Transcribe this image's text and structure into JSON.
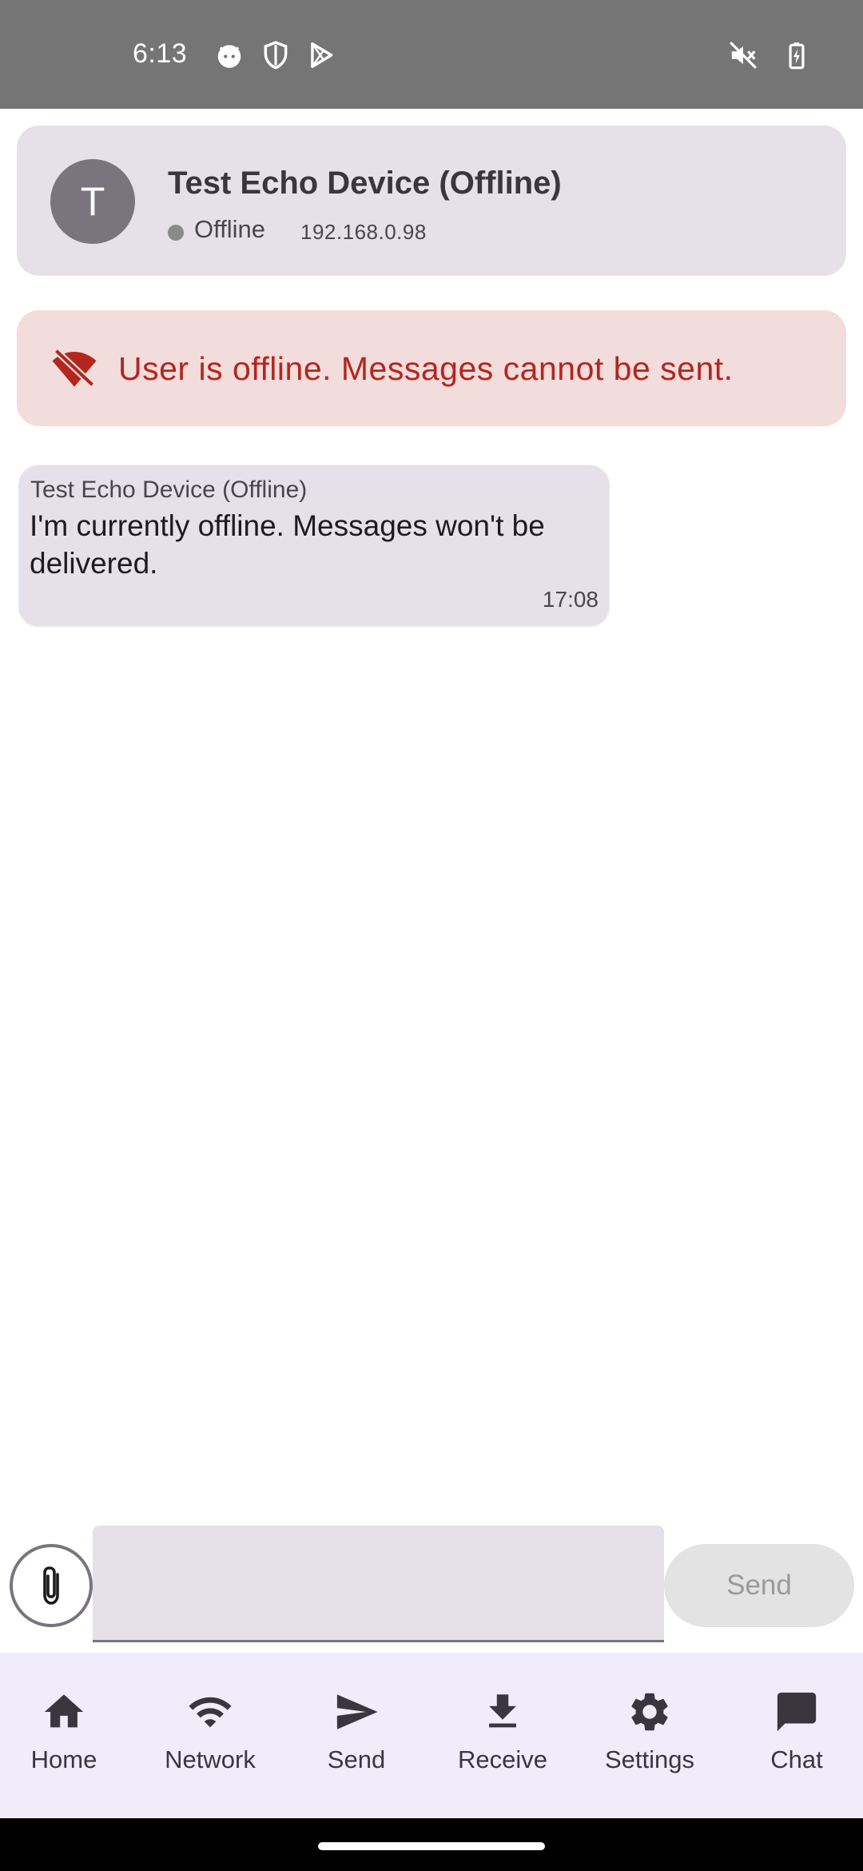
{
  "status_bar": {
    "time": "6:13",
    "left_icons": [
      "cat-face-icon",
      "shield-icon",
      "play-store-icon"
    ],
    "right_icons": [
      "mute-icon",
      "battery-charging-icon"
    ]
  },
  "contact": {
    "avatar_letter": "T",
    "name": "Test Echo Device (Offline)",
    "status": "Offline",
    "ip": "192.168.0.98",
    "status_color": "#8a8a8a"
  },
  "warning": {
    "icon": "wifi-off-icon",
    "text": "User is offline. Messages cannot be sent.",
    "color": "#b3261e"
  },
  "messages": [
    {
      "sender": "Test Echo Device (Offline)",
      "body": "I'm currently offline. Messages won't be delivered.",
      "time": "17:08"
    }
  ],
  "composer": {
    "input_value": "",
    "input_placeholder": "",
    "send_label": "Send",
    "attach_icon": "paperclip-icon"
  },
  "nav": {
    "items": [
      {
        "label": "Home",
        "icon": "home-icon"
      },
      {
        "label": "Network",
        "icon": "wifi-icon"
      },
      {
        "label": "Send",
        "icon": "send-icon"
      },
      {
        "label": "Receive",
        "icon": "download-icon"
      },
      {
        "label": "Settings",
        "icon": "gear-icon"
      },
      {
        "label": "Chat",
        "icon": "chat-icon"
      }
    ]
  },
  "colors": {
    "card_bg": "#e6e0e9",
    "banner_bg": "#f2dcdc",
    "nav_bg": "#f1ecfa"
  }
}
